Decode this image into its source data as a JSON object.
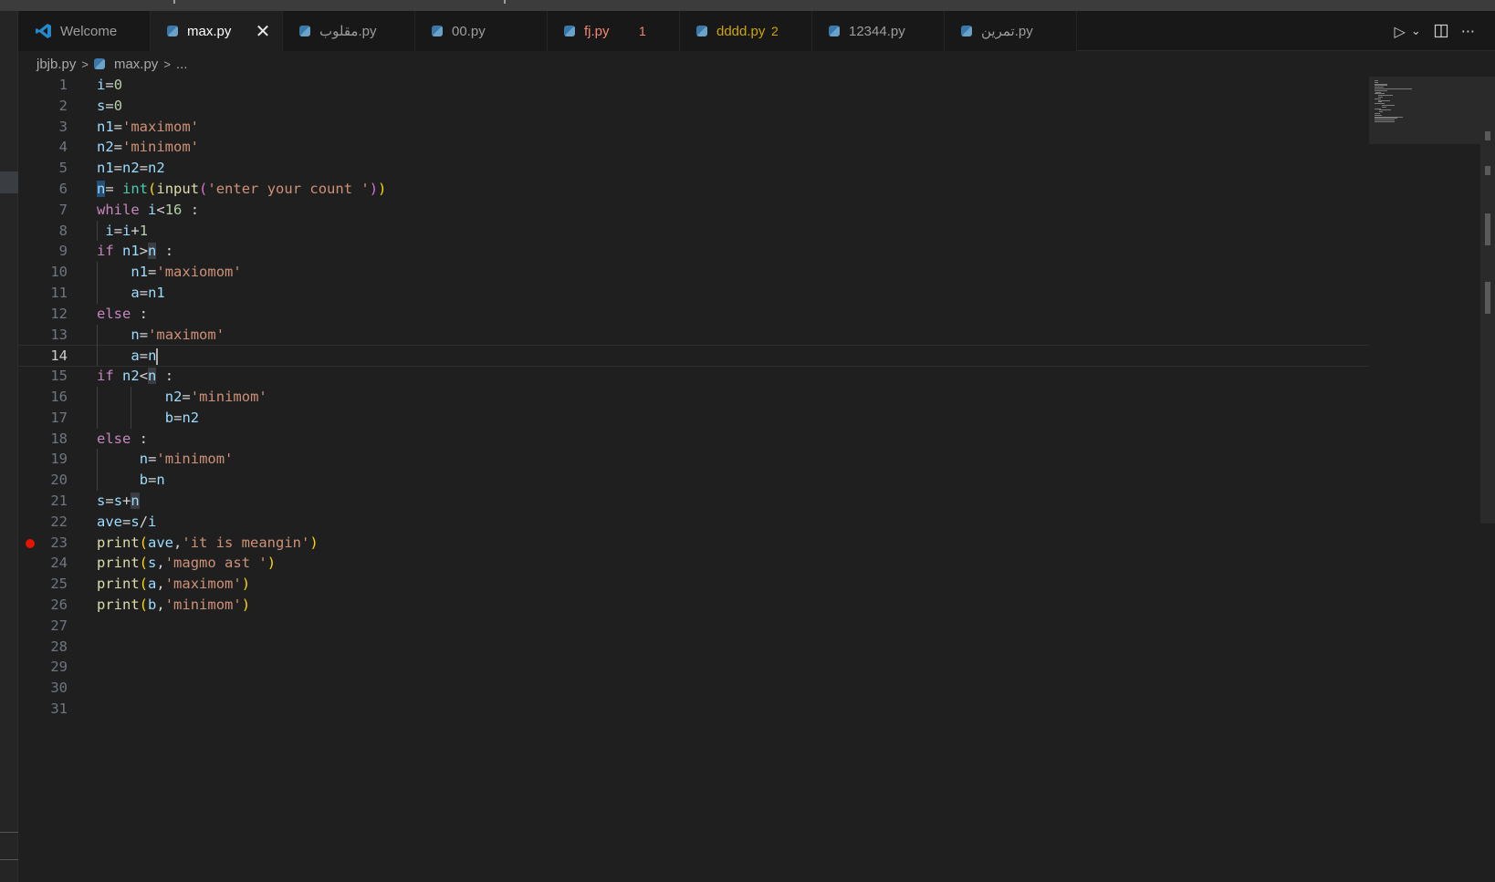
{
  "tabs": [
    {
      "label": "Welcome",
      "icon": "vscode-icon",
      "state": "normal"
    },
    {
      "label": "max.py",
      "icon": "python-icon",
      "state": "active"
    },
    {
      "label": "مقلوب.py",
      "icon": "python-icon",
      "state": "normal"
    },
    {
      "label": "00.py",
      "icon": "python-icon",
      "state": "normal"
    },
    {
      "label": "fj.py",
      "icon": "python-icon",
      "state": "error",
      "count": "1"
    },
    {
      "label": "dddd.py",
      "icon": "python-icon",
      "state": "warning",
      "count": "2"
    },
    {
      "label": "12344.py",
      "icon": "python-icon",
      "state": "normal"
    },
    {
      "label": "تمرين.py",
      "icon": "python-icon",
      "state": "normal"
    }
  ],
  "tab_close_glyph": "✕",
  "actions": {
    "run_icon": "run-icon",
    "run_glyph": "▷",
    "dropdown_glyph": "⌄",
    "split_icon": "split-editor-icon",
    "more_glyph": "···"
  },
  "breadcrumb": {
    "folder": "jbjb.py",
    "file": "max.py",
    "tail": "...",
    "sep": ">"
  },
  "editor": {
    "current_line": 14,
    "breakpoint_line": 23,
    "line_numbers": [
      "1",
      "2",
      "3",
      "4",
      "5",
      "6",
      "7",
      "8",
      "9",
      "10",
      "11",
      "12",
      "13",
      "14",
      "15",
      "16",
      "17",
      "18",
      "19",
      "20",
      "21",
      "22",
      "23",
      "24",
      "25",
      "26",
      "27",
      "28",
      "29",
      "30",
      "31"
    ],
    "lines": [
      "i=0",
      "s=0",
      "n1='maximom'",
      "n2='minimom'",
      "n1=n2=n2",
      "n= int(input('enter your count '))",
      "while i<16 :",
      " i=i+1",
      "if n1>n :",
      "    n1='maxiomom'",
      "    a=n1",
      "else :",
      "    n='maximom'",
      "    a=n",
      "if n2<n :",
      "        n2='minimom'",
      "        b=n2",
      "else :",
      "     n='minimom'",
      "     b=n",
      "s=s+n",
      "ave=s/i",
      "print(ave,'it is meangin')",
      "print(s,'magmo ast ')",
      "print(a,'maximom')",
      "print(b,'minimom')",
      "",
      "",
      "",
      "",
      ""
    ]
  },
  "colors": {
    "background": "#1f1f1f",
    "tab_active": "#1f1f1f",
    "error": "#f48771",
    "warning": "#cca700",
    "breakpoint": "#e51400",
    "keyword": "#c586c0",
    "string": "#ce9178",
    "variable": "#9cdcfe",
    "function": "#dcdcaa",
    "number": "#b5cea8"
  }
}
